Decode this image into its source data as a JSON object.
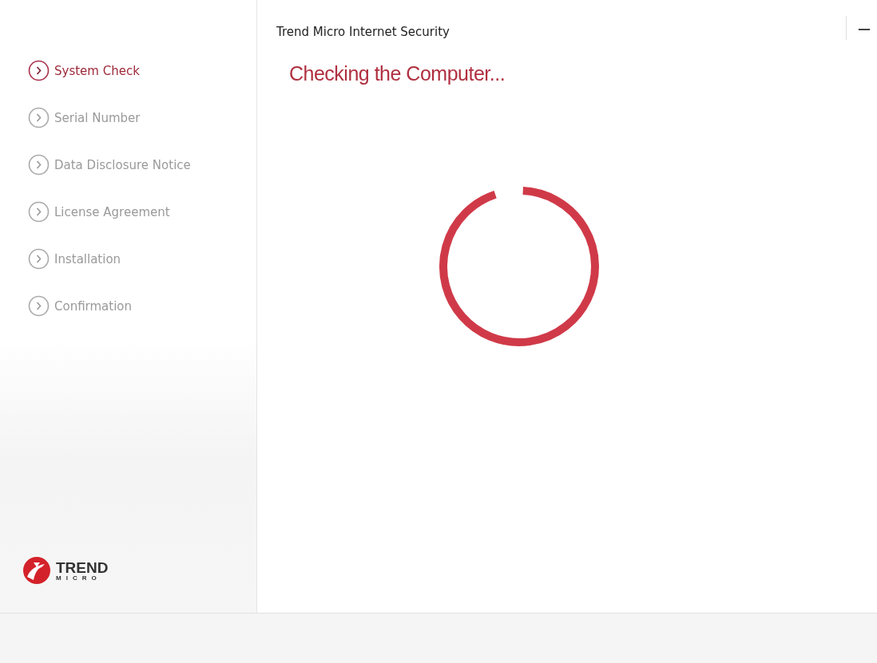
{
  "window": {
    "title": "Trend Micro Internet Security",
    "minimize": "—"
  },
  "steps": [
    {
      "label": "System Check",
      "selected": true
    },
    {
      "label": "Serial Number",
      "selected": false
    },
    {
      "label": "Data Disclosure Notice",
      "selected": false
    },
    {
      "label": "License Agreement",
      "selected": false
    },
    {
      "label": "Installation",
      "selected": false
    },
    {
      "label": "Confirmation",
      "selected": false
    }
  ],
  "heading": "Checking the Computer...",
  "logo": {
    "line_1": "TREND",
    "line_2": "MICRO"
  }
}
